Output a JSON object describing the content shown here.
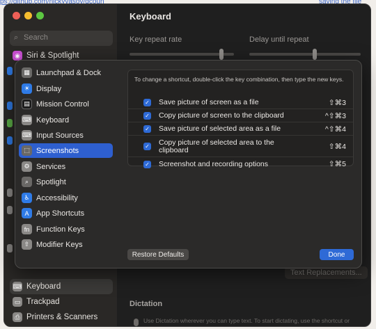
{
  "background": {
    "link_left": "ps://github.com/nickyvasov/dcoun",
    "link_right": "saving the file"
  },
  "window": {
    "title": "Keyboard",
    "search_placeholder": "Search",
    "sidebar_items": [
      {
        "label": "Siri & Spotlight",
        "icon": "siri-icon"
      },
      {
        "label": "Keyboard",
        "icon": "keyboard-icon"
      },
      {
        "label": "Trackpad",
        "icon": "trackpad-icon"
      },
      {
        "label": "Printers & Scanners",
        "icon": "printer-icon"
      }
    ],
    "key_repeat_label": "Key repeat rate",
    "delay_label": "Delay until repeat",
    "text_replacements_button": "Text Replacements...",
    "dictation_title": "Dictation",
    "dictation_text": "Use Dictation wherever you can type text. To start dictating, use the shortcut or select Start Dictation from the Edit menu."
  },
  "overlay": {
    "categories": [
      {
        "label": "Launchpad & Dock",
        "icon": "launchpad-icon",
        "color": "#6b6a68"
      },
      {
        "label": "Display",
        "icon": "display-icon",
        "color": "#2f7be6"
      },
      {
        "label": "Mission Control",
        "icon": "mission-control-icon",
        "color": "#1c1c1c"
      },
      {
        "label": "Keyboard",
        "icon": "keyboard-icon",
        "color": "#8a8886"
      },
      {
        "label": "Input Sources",
        "icon": "input-sources-icon",
        "color": "#8a8886"
      },
      {
        "label": "Screenshots",
        "icon": "screenshot-icon",
        "color": "#6a6866",
        "selected": true
      },
      {
        "label": "Services",
        "icon": "gear-icon",
        "color": "#8a8886"
      },
      {
        "label": "Spotlight",
        "icon": "spotlight-icon",
        "color": "#6a6866"
      },
      {
        "label": "Accessibility",
        "icon": "accessibility-icon",
        "color": "#2f7be6"
      },
      {
        "label": "App Shortcuts",
        "icon": "app-shortcuts-icon",
        "color": "#2f7be6"
      },
      {
        "label": "Function Keys",
        "icon": "function-keys-icon",
        "color": "#8a8886"
      },
      {
        "label": "Modifier Keys",
        "icon": "modifier-keys-icon",
        "color": "#8a8886"
      }
    ],
    "description": "To change a shortcut, double-click the key combination, then type the new keys.",
    "shortcuts": [
      {
        "label": "Save picture of screen as a file",
        "keys": "⇧⌘3",
        "checked": true
      },
      {
        "label": "Copy picture of screen to the clipboard",
        "keys": "^⇧⌘3",
        "checked": true
      },
      {
        "label": "Save picture of selected area as a file",
        "keys": "^⇧⌘4",
        "checked": true
      },
      {
        "label": "Copy picture of selected area to the clipboard",
        "keys": "⇧⌘4",
        "checked": true
      },
      {
        "label": "Screenshot and recording options",
        "keys": "⇧⌘5",
        "checked": true
      }
    ],
    "restore_label": "Restore Defaults",
    "done_label": "Done"
  },
  "colors": {
    "accent": "#2e6ad6",
    "selected_row": "#2e5fcf"
  }
}
